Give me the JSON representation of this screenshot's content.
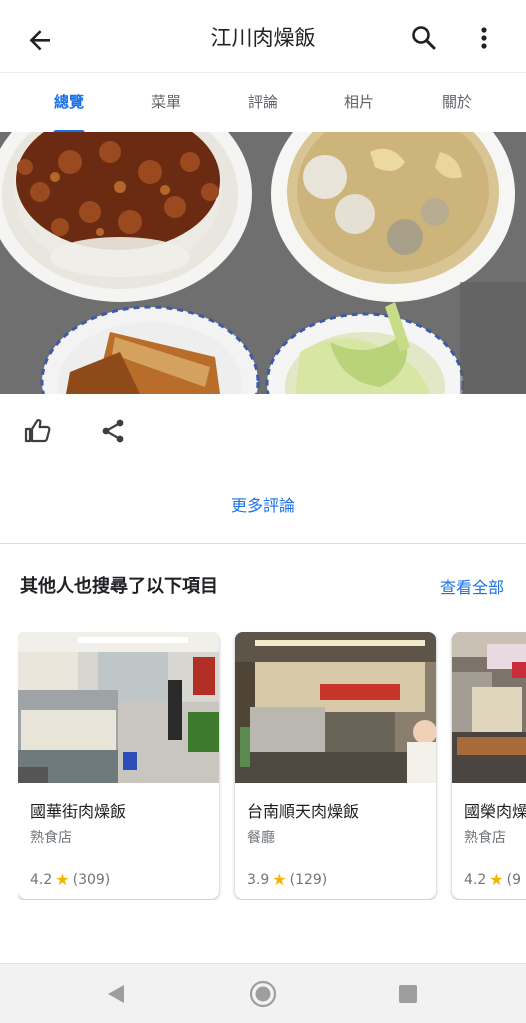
{
  "appbar": {
    "title": "江川肉燥飯",
    "back_icon": "arrow-back-icon",
    "search_icon": "search-icon",
    "more_icon": "more-vert-icon"
  },
  "tabs": [
    {
      "label": "總覽",
      "active": true
    },
    {
      "label": "菜單",
      "active": false
    },
    {
      "label": "評論",
      "active": false
    },
    {
      "label": "相片",
      "active": false
    },
    {
      "label": "關於",
      "active": false
    }
  ],
  "actions": {
    "like_icon": "thumb-up-icon",
    "share_icon": "share-icon"
  },
  "more_reviews": "更多評論",
  "related": {
    "title": "其他人也搜尋了以下項目",
    "see_all": "查看全部",
    "cards": [
      {
        "name": "國華街肉燥飯",
        "category": "熟食店",
        "rating": "4.2",
        "count": "(309)"
      },
      {
        "name": "台南順天肉燥飯",
        "category": "餐廳",
        "rating": "3.9",
        "count": "(129)"
      },
      {
        "name": "國榮肉燥飯",
        "category": "熟食店",
        "rating": "4.2",
        "count": "(9"
      }
    ]
  },
  "navbar": {
    "back_icon": "nav-back-icon",
    "home_icon": "nav-home-icon",
    "recents_icon": "nav-recents-icon"
  },
  "colors": {
    "accent": "#1a73e8",
    "star": "#f4b400",
    "secondary_text": "#70757a"
  }
}
